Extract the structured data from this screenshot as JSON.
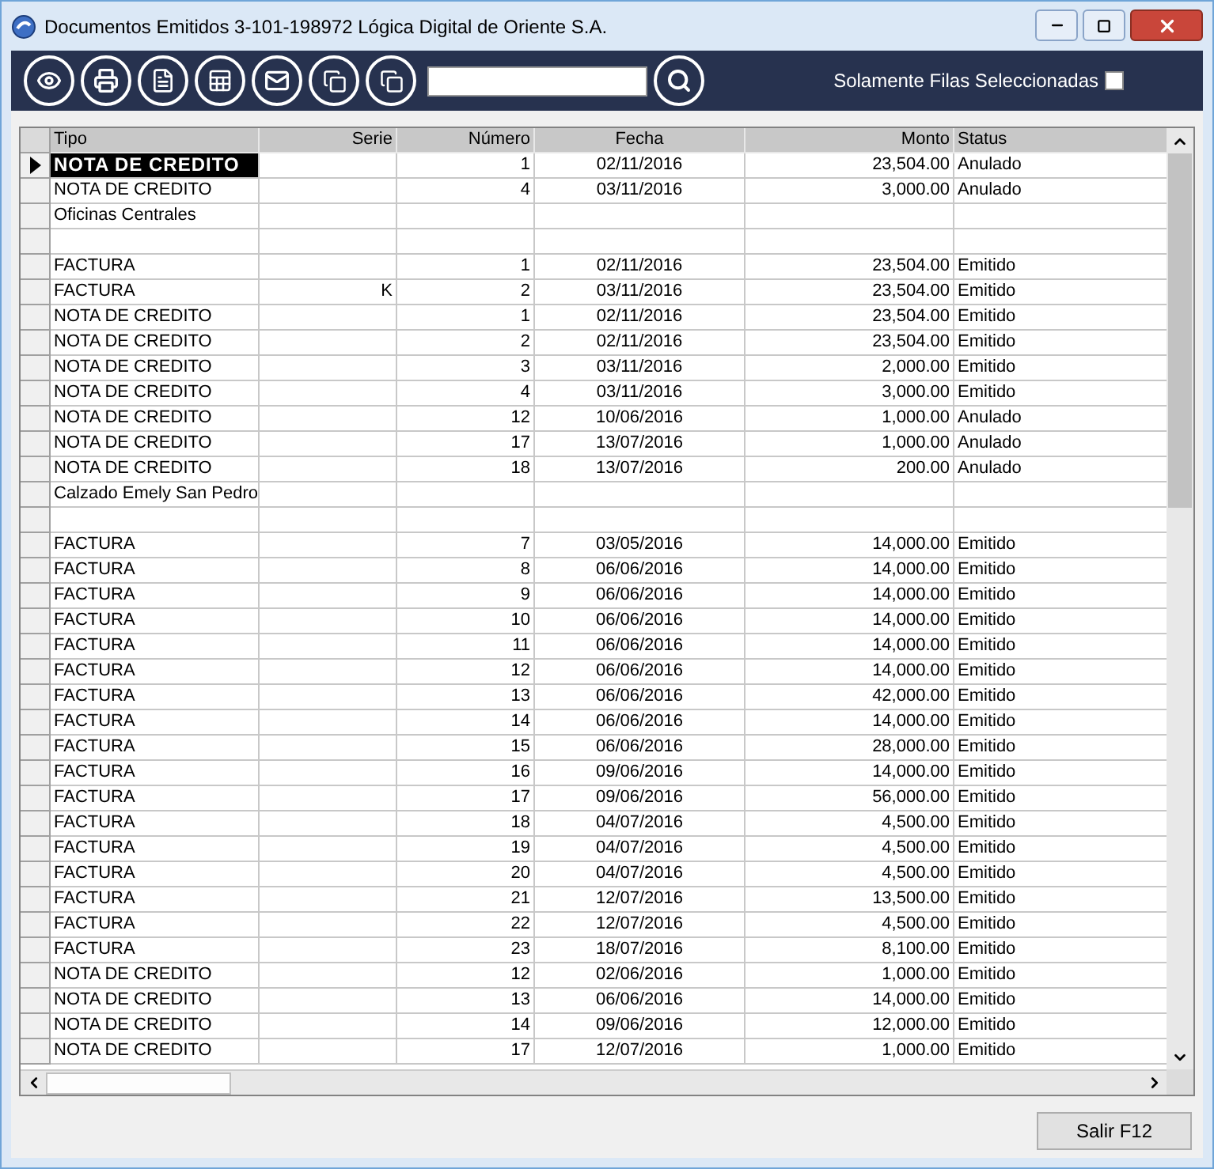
{
  "window": {
    "title": "Documentos Emitidos 3-101-198972 Lógica Digital de Oriente S.A."
  },
  "toolbar": {
    "filter": {
      "label": "Solamente Filas Seleccionadas",
      "checked": false
    }
  },
  "table": {
    "columns": [
      "Tipo",
      "Serie",
      "Número",
      "Fecha",
      "Monto",
      "Status"
    ],
    "rows": [
      {
        "kind": "doc",
        "selected": true,
        "cells": [
          "NOTA DE CREDITO",
          "",
          "1",
          "02/11/2016",
          "23,504.00",
          "Anulado"
        ]
      },
      {
        "kind": "doc",
        "selected": false,
        "cells": [
          "NOTA DE CREDITO",
          "",
          "4",
          "03/11/2016",
          "3,000.00",
          "Anulado"
        ]
      },
      {
        "kind": "group",
        "selected": false,
        "cells": [
          "Oficinas Centrales"
        ]
      },
      {
        "kind": "blank",
        "selected": false
      },
      {
        "kind": "doc",
        "selected": false,
        "cells": [
          "FACTURA",
          "",
          "1",
          "02/11/2016",
          "23,504.00",
          "Emitido"
        ]
      },
      {
        "kind": "doc",
        "selected": false,
        "cells": [
          "FACTURA",
          "K",
          "2",
          "03/11/2016",
          "23,504.00",
          "Emitido"
        ]
      },
      {
        "kind": "doc",
        "selected": false,
        "cells": [
          "NOTA DE CREDITO",
          "",
          "1",
          "02/11/2016",
          "23,504.00",
          "Emitido"
        ]
      },
      {
        "kind": "doc",
        "selected": false,
        "cells": [
          "NOTA DE CREDITO",
          "",
          "2",
          "02/11/2016",
          "23,504.00",
          "Emitido"
        ]
      },
      {
        "kind": "doc",
        "selected": false,
        "cells": [
          "NOTA DE CREDITO",
          "",
          "3",
          "03/11/2016",
          "2,000.00",
          "Emitido"
        ]
      },
      {
        "kind": "doc",
        "selected": false,
        "cells": [
          "NOTA DE CREDITO",
          "",
          "4",
          "03/11/2016",
          "3,000.00",
          "Emitido"
        ]
      },
      {
        "kind": "doc",
        "selected": false,
        "cells": [
          "NOTA DE CREDITO",
          "",
          "12",
          "10/06/2016",
          "1,000.00",
          "Anulado"
        ]
      },
      {
        "kind": "doc",
        "selected": false,
        "cells": [
          "NOTA DE CREDITO",
          "",
          "17",
          "13/07/2016",
          "1,000.00",
          "Anulado"
        ]
      },
      {
        "kind": "doc",
        "selected": false,
        "cells": [
          "NOTA DE CREDITO",
          "",
          "18",
          "13/07/2016",
          "200.00",
          "Anulado"
        ]
      },
      {
        "kind": "group",
        "selected": false,
        "cells": [
          "Calzado Emely San Pedro"
        ]
      },
      {
        "kind": "blank",
        "selected": false
      },
      {
        "kind": "doc",
        "selected": false,
        "cells": [
          "FACTURA",
          "",
          "7",
          "03/05/2016",
          "14,000.00",
          "Emitido"
        ]
      },
      {
        "kind": "doc",
        "selected": false,
        "cells": [
          "FACTURA",
          "",
          "8",
          "06/06/2016",
          "14,000.00",
          "Emitido"
        ]
      },
      {
        "kind": "doc",
        "selected": false,
        "cells": [
          "FACTURA",
          "",
          "9",
          "06/06/2016",
          "14,000.00",
          "Emitido"
        ]
      },
      {
        "kind": "doc",
        "selected": false,
        "cells": [
          "FACTURA",
          "",
          "10",
          "06/06/2016",
          "14,000.00",
          "Emitido"
        ]
      },
      {
        "kind": "doc",
        "selected": false,
        "cells": [
          "FACTURA",
          "",
          "11",
          "06/06/2016",
          "14,000.00",
          "Emitido"
        ]
      },
      {
        "kind": "doc",
        "selected": false,
        "cells": [
          "FACTURA",
          "",
          "12",
          "06/06/2016",
          "14,000.00",
          "Emitido"
        ]
      },
      {
        "kind": "doc",
        "selected": false,
        "cells": [
          "FACTURA",
          "",
          "13",
          "06/06/2016",
          "42,000.00",
          "Emitido"
        ]
      },
      {
        "kind": "doc",
        "selected": false,
        "cells": [
          "FACTURA",
          "",
          "14",
          "06/06/2016",
          "14,000.00",
          "Emitido"
        ]
      },
      {
        "kind": "doc",
        "selected": false,
        "cells": [
          "FACTURA",
          "",
          "15",
          "06/06/2016",
          "28,000.00",
          "Emitido"
        ]
      },
      {
        "kind": "doc",
        "selected": false,
        "cells": [
          "FACTURA",
          "",
          "16",
          "09/06/2016",
          "14,000.00",
          "Emitido"
        ]
      },
      {
        "kind": "doc",
        "selected": false,
        "cells": [
          "FACTURA",
          "",
          "17",
          "09/06/2016",
          "56,000.00",
          "Emitido"
        ]
      },
      {
        "kind": "doc",
        "selected": false,
        "cells": [
          "FACTURA",
          "",
          "18",
          "04/07/2016",
          "4,500.00",
          "Emitido"
        ]
      },
      {
        "kind": "doc",
        "selected": false,
        "cells": [
          "FACTURA",
          "",
          "19",
          "04/07/2016",
          "4,500.00",
          "Emitido"
        ]
      },
      {
        "kind": "doc",
        "selected": false,
        "cells": [
          "FACTURA",
          "",
          "20",
          "04/07/2016",
          "4,500.00",
          "Emitido"
        ]
      },
      {
        "kind": "doc",
        "selected": false,
        "cells": [
          "FACTURA",
          "",
          "21",
          "12/07/2016",
          "13,500.00",
          "Emitido"
        ]
      },
      {
        "kind": "doc",
        "selected": false,
        "cells": [
          "FACTURA",
          "",
          "22",
          "12/07/2016",
          "4,500.00",
          "Emitido"
        ]
      },
      {
        "kind": "doc",
        "selected": false,
        "cells": [
          "FACTURA",
          "",
          "23",
          "18/07/2016",
          "8,100.00",
          "Emitido"
        ]
      },
      {
        "kind": "doc",
        "selected": false,
        "cells": [
          "NOTA DE CREDITO",
          "",
          "12",
          "02/06/2016",
          "1,000.00",
          "Emitido"
        ]
      },
      {
        "kind": "doc",
        "selected": false,
        "cells": [
          "NOTA DE CREDITO",
          "",
          "13",
          "06/06/2016",
          "14,000.00",
          "Emitido"
        ]
      },
      {
        "kind": "doc",
        "selected": false,
        "cells": [
          "NOTA DE CREDITO",
          "",
          "14",
          "09/06/2016",
          "12,000.00",
          "Emitido"
        ]
      },
      {
        "kind": "doc",
        "selected": false,
        "cells": [
          "NOTA DE CREDITO",
          "",
          "17",
          "12/07/2016",
          "1,000.00",
          "Emitido"
        ]
      }
    ]
  },
  "buttons": [
    "Salir F12"
  ]
}
